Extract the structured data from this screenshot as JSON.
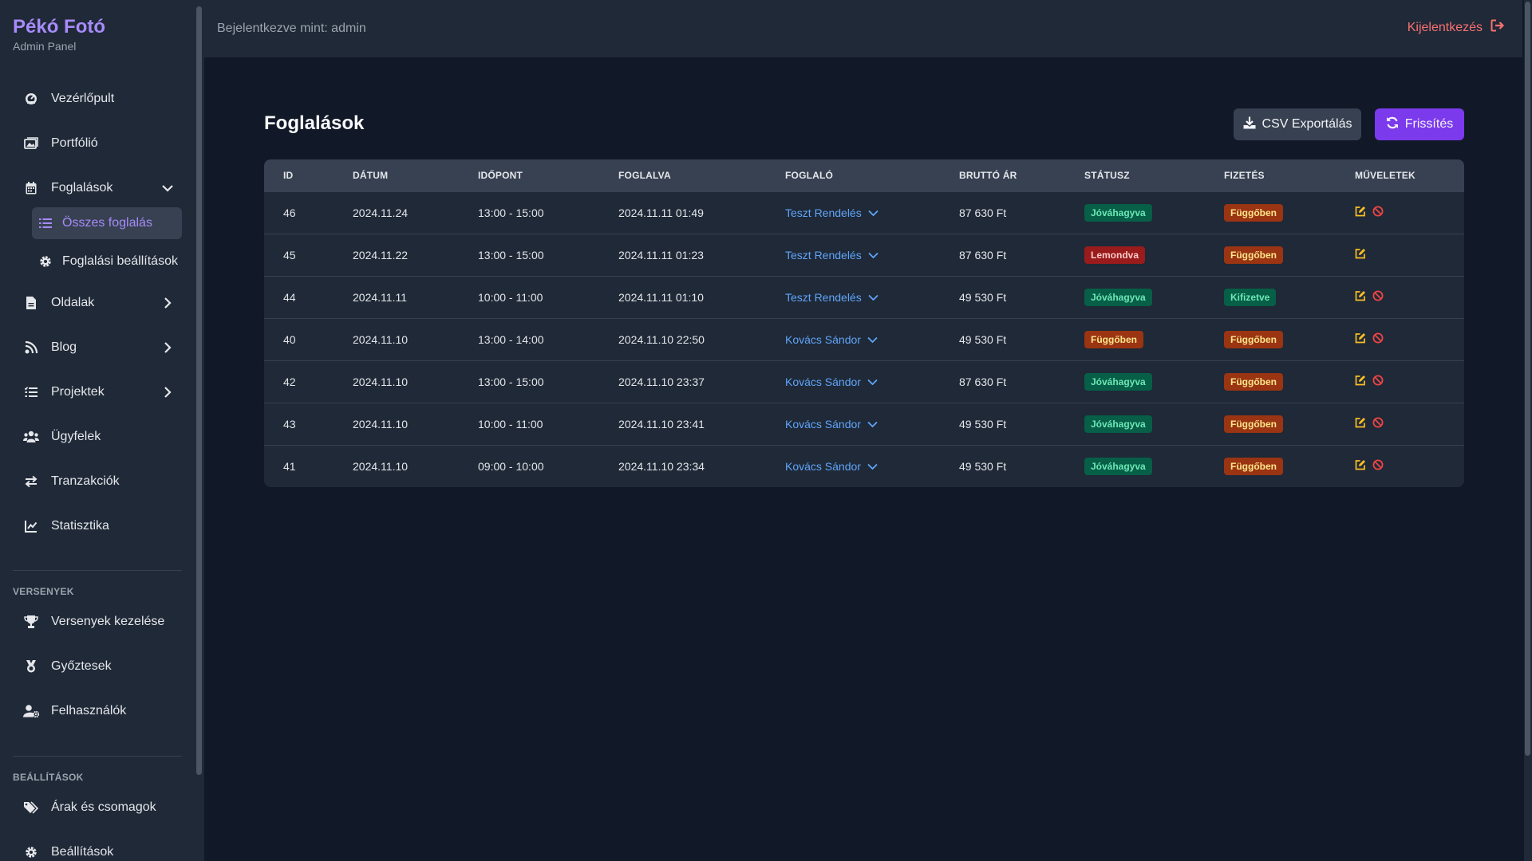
{
  "brand": {
    "title": "Pékó Fotó",
    "subtitle": "Admin Panel"
  },
  "sidebar": {
    "items": [
      {
        "label": "Vezérlőpult",
        "icon": "dashboard-icon"
      },
      {
        "label": "Portfólió",
        "icon": "images-icon"
      },
      {
        "label": "Foglalások",
        "icon": "calendar-icon",
        "expanded": true
      },
      {
        "label": "Oldalak",
        "icon": "file-icon"
      },
      {
        "label": "Blog",
        "icon": "blog-icon"
      },
      {
        "label": "Projektek",
        "icon": "list-icon"
      },
      {
        "label": "Ügyfelek",
        "icon": "users-icon"
      },
      {
        "label": "Tranzakciók",
        "icon": "exchange-icon"
      },
      {
        "label": "Statisztika",
        "icon": "chart-line-icon"
      }
    ],
    "sub_items": [
      {
        "label": "Összes foglalás",
        "icon": "list-icon",
        "active": true
      },
      {
        "label": "Foglalási beállítások",
        "icon": "gear-icon"
      }
    ],
    "sections": [
      {
        "label": "VERSENYEK",
        "items": [
          {
            "label": "Versenyek kezelése",
            "icon": "trophy-icon"
          },
          {
            "label": "Győztesek",
            "icon": "medal-icon"
          },
          {
            "label": "Felhasználók",
            "icon": "user-gear-icon"
          }
        ]
      },
      {
        "label": "BEÁLLÍTÁSOK",
        "items": [
          {
            "label": "Árak és csomagok",
            "icon": "tags-icon"
          },
          {
            "label": "Beállítások",
            "icon": "gear-icon"
          }
        ]
      }
    ]
  },
  "topbar": {
    "logged_in": "Bejelentkezve mint: admin",
    "logout": "Kijelentkezés"
  },
  "page": {
    "title": "Foglalások",
    "csv_button": "CSV Exportálás",
    "refresh_button": "Frissítés"
  },
  "colors": {
    "accent": "#7c3aed",
    "link": "#60a5fa",
    "logout": "#f87171",
    "approved_bg": "#065f46",
    "approved_fg": "#6ee7b7",
    "cancelled_bg": "#991b1b",
    "cancelled_fg": "#fecaca",
    "pending_bg": "#9a3412",
    "pending_fg": "#fde68a",
    "edit_icon": "#fbbf24",
    "cancel_icon": "#ef4444"
  },
  "table": {
    "columns": [
      "ID",
      "DÁTUM",
      "IDŐPONT",
      "FOGLALVA",
      "FOGLALÓ",
      "BRUTTÓ ÁR",
      "STÁTUSZ",
      "FIZETÉS",
      "MŰVELETEK"
    ],
    "rows": [
      {
        "id": "46",
        "date": "2024.11.24",
        "time": "13:00 - 15:00",
        "booked": "2024.11.11 01:49",
        "booker": "Teszt Rendelés",
        "price": "87 630 Ft",
        "status": "Jóváhagyva",
        "status_kind": "approved",
        "payment": "Függőben",
        "payment_kind": "pending",
        "can_cancel": true
      },
      {
        "id": "45",
        "date": "2024.11.22",
        "time": "13:00 - 15:00",
        "booked": "2024.11.11 01:23",
        "booker": "Teszt Rendelés",
        "price": "87 630 Ft",
        "status": "Lemondva",
        "status_kind": "cancelled",
        "payment": "Függőben",
        "payment_kind": "pending",
        "can_cancel": false
      },
      {
        "id": "44",
        "date": "2024.11.11",
        "time": "10:00 - 11:00",
        "booked": "2024.11.11 01:10",
        "booker": "Teszt Rendelés",
        "price": "49 530 Ft",
        "status": "Jóváhagyva",
        "status_kind": "approved",
        "payment": "Kifizetve",
        "payment_kind": "paid",
        "can_cancel": true
      },
      {
        "id": "40",
        "date": "2024.11.10",
        "time": "13:00 - 14:00",
        "booked": "2024.11.10 22:50",
        "booker": "Kovács Sándor",
        "price": "49 530 Ft",
        "status": "Függőben",
        "status_kind": "pending",
        "payment": "Függőben",
        "payment_kind": "pending",
        "can_cancel": true
      },
      {
        "id": "42",
        "date": "2024.11.10",
        "time": "13:00 - 15:00",
        "booked": "2024.11.10 23:37",
        "booker": "Kovács Sándor",
        "price": "87 630 Ft",
        "status": "Jóváhagyva",
        "status_kind": "approved",
        "payment": "Függőben",
        "payment_kind": "pending",
        "can_cancel": true
      },
      {
        "id": "43",
        "date": "2024.11.10",
        "time": "10:00 - 11:00",
        "booked": "2024.11.10 23:41",
        "booker": "Kovács Sándor",
        "price": "49 530 Ft",
        "status": "Jóváhagyva",
        "status_kind": "approved",
        "payment": "Függőben",
        "payment_kind": "pending",
        "can_cancel": true
      },
      {
        "id": "41",
        "date": "2024.11.10",
        "time": "09:00 - 10:00",
        "booked": "2024.11.10 23:34",
        "booker": "Kovács Sándor",
        "price": "49 530 Ft",
        "status": "Jóváhagyva",
        "status_kind": "approved",
        "payment": "Függőben",
        "payment_kind": "pending",
        "can_cancel": true
      }
    ]
  }
}
